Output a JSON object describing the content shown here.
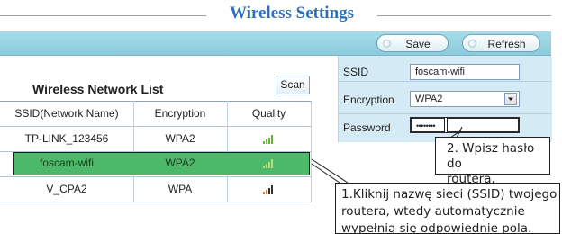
{
  "page": {
    "title": "Wireless Settings"
  },
  "toolbar": {
    "save_label": "Save",
    "refresh_label": "Refresh"
  },
  "network_list": {
    "heading": "Wireless Network List",
    "scan_label": "Scan",
    "columns": [
      "SSID(Network Name)",
      "Encryption",
      "Quality"
    ],
    "rows": [
      {
        "ssid": "TP-LINK_123456",
        "encryption": "WPA2",
        "quality_icon": "signal-strength-icon",
        "selected": false
      },
      {
        "ssid": "foscam-wifi",
        "encryption": "WPA2",
        "quality_icon": "signal-strength-icon",
        "selected": true
      },
      {
        "ssid": "V_CPA2",
        "encryption": "WPA",
        "quality_icon": "signal-strength-icon",
        "selected": false
      }
    ]
  },
  "settings": {
    "ssid_label": "SSID",
    "ssid_value": "foscam-wifi",
    "encryption_label": "Encryption",
    "encryption_value": "WPA2",
    "password_label": "Password",
    "password_value": "••••••••"
  },
  "callouts": {
    "step2_line1": "2. Wpisz hasło do",
    "step2_line2": "routera.",
    "step1_line1": "1.Kliknij nazwę sieci (SSID) twojego",
    "step1_line2": "routera, wtedy automatycznie",
    "step1_line3": "wypełnią się odpowiednie pola."
  },
  "colors": {
    "title": "#2f6fba",
    "toolbar": "#9dd6e6",
    "selected_row": "#4cb96a",
    "settings_panel": "#d4ebf6"
  }
}
